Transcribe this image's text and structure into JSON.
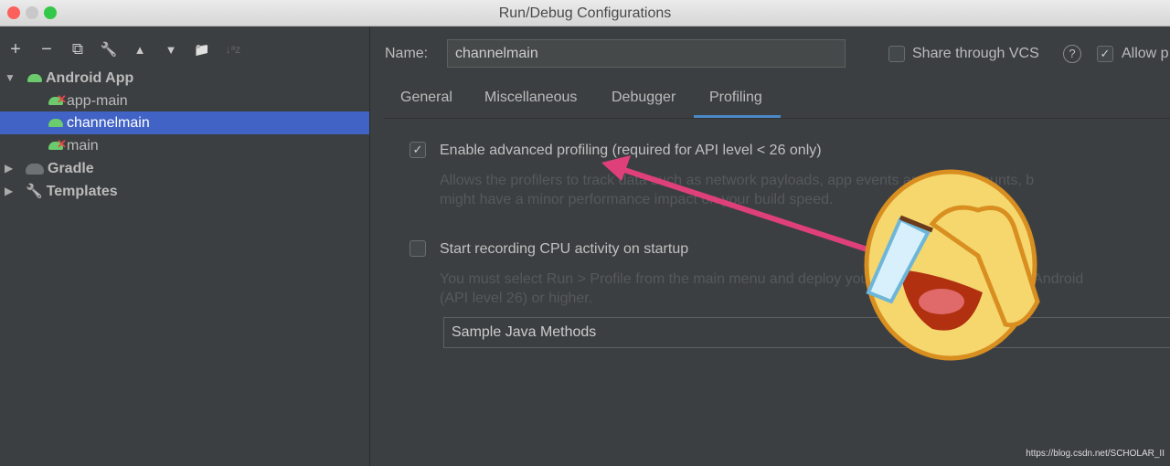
{
  "window": {
    "title": "Run/Debug Configurations"
  },
  "toolbar": {
    "icons": [
      "plus-icon",
      "minus-icon",
      "copy-icon",
      "wrench-icon",
      "arrow-up-icon",
      "arrow-down-icon",
      "folder-add-icon",
      "sort-az-icon"
    ],
    "add": "+",
    "remove": "−",
    "copy": "⧉",
    "edit": "🔧",
    "up": "▲",
    "down": "▼",
    "folder": "📁",
    "sort": "↓ᵃz"
  },
  "tree": {
    "android_app": "Android App",
    "items": [
      "app-main",
      "channelmain",
      "main"
    ],
    "gradle": "Gradle",
    "templates": "Templates"
  },
  "form": {
    "name_label": "Name:",
    "name_value": "channelmain",
    "share_vcs": "Share through VCS",
    "share_checked": false,
    "allow": "Allow p",
    "allow_checked": true,
    "help": "?"
  },
  "tabs": [
    "General",
    "Miscellaneous",
    "Debugger",
    "Profiling"
  ],
  "active_tab": "Profiling",
  "profiling": {
    "advanced_label": "Enable advanced profiling (required for API level < 26 only)",
    "advanced_checked": true,
    "advanced_desc1": "Allows the profilers to track data such as network payloads, app events and object counts, b",
    "advanced_desc2": "might have a minor performance impact on your build speed.",
    "cpu_label": "Start recording CPU activity on startup",
    "cpu_checked": false,
    "cpu_desc1": "You must select Run > Profile from the main menu and deploy your app to a device running Android",
    "cpu_desc2": "(API level 26) or higher.",
    "method": "Sample Java Methods"
  },
  "watermark": "https://blog.csdn.net/SCHOLAR_II",
  "colors": {
    "selection": "#4163c6",
    "arrow": "#e0407a",
    "tab_underline": "#4a88c7"
  }
}
